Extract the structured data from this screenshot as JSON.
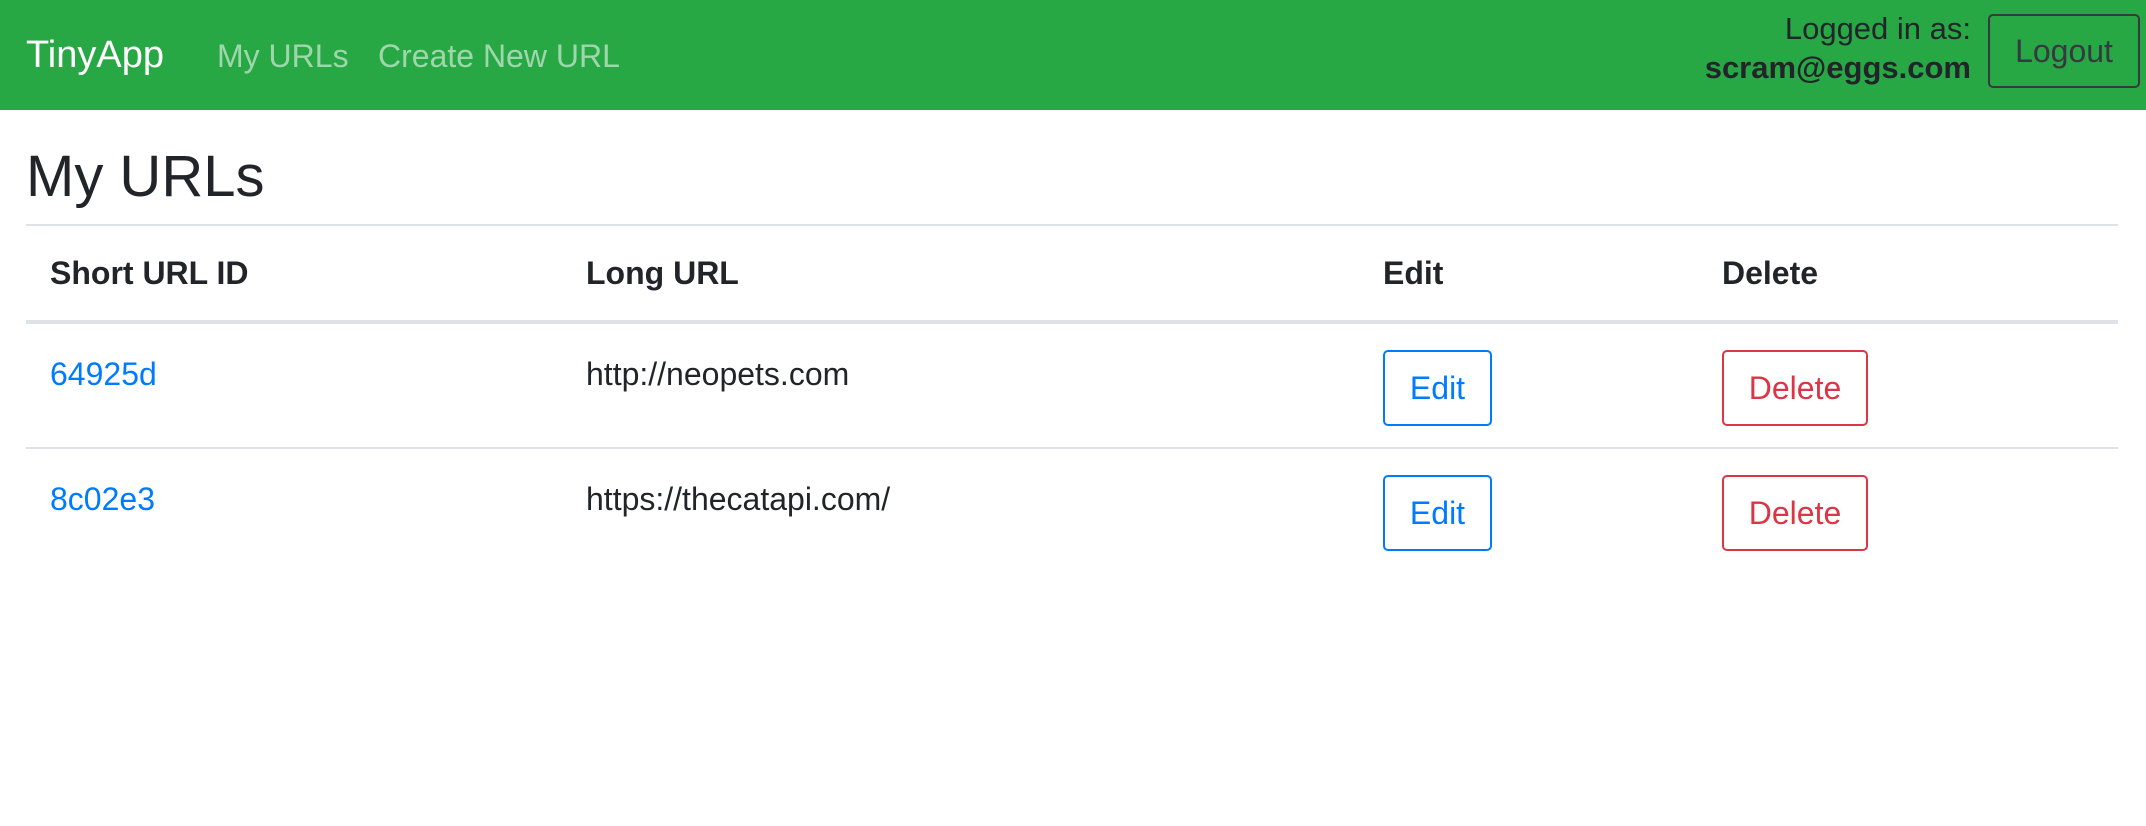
{
  "navbar": {
    "brand": "TinyApp",
    "links": [
      {
        "label": "My URLs"
      },
      {
        "label": "Create New URL"
      }
    ],
    "login_label": "Logged in as:",
    "user_email": "scram@eggs.com",
    "logout_label": "Logout",
    "background_color": "#28a745"
  },
  "main": {
    "title": "My URLs",
    "table": {
      "headers": [
        "Short URL ID",
        "Long URL",
        "Edit",
        "Delete"
      ],
      "rows": [
        {
          "short_id": "64925d",
          "long_url": "http://neopets.com",
          "edit_label": "Edit",
          "delete_label": "Delete"
        },
        {
          "short_id": "8c02e3",
          "long_url": "https://thecatapi.com/",
          "edit_label": "Edit",
          "delete_label": "Delete"
        }
      ]
    }
  },
  "colors": {
    "link": "#007bff",
    "danger": "#dc3545",
    "dark_outline": "#343a40"
  }
}
